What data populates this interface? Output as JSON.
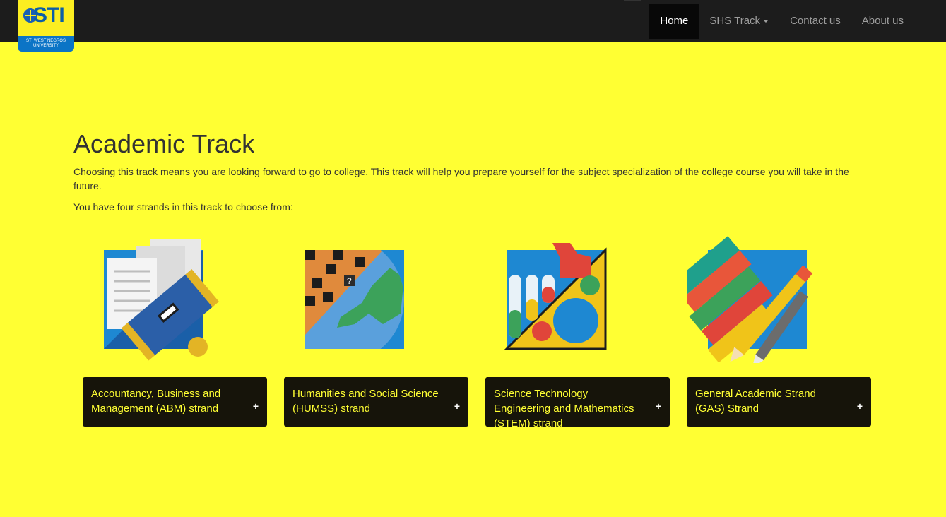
{
  "brand": {
    "logo_text": "STI",
    "logo_subtitle": [
      "STI West Negros",
      "University"
    ]
  },
  "nav": {
    "items": [
      {
        "label": "Home",
        "active": true
      },
      {
        "label": "SHS Track",
        "dropdown": true
      },
      {
        "label": "Contact us"
      },
      {
        "label": "About us"
      }
    ]
  },
  "page": {
    "title": "Academic Track",
    "intro": "Choosing this track means you are looking forward to go to college. This track will help you prepare yourself for the subject specialization of the college course you will take in the future.",
    "choose": "You have four strands in this track to choose from:"
  },
  "strands": [
    {
      "title": "Accountancy, Business and Management (ABM) strand",
      "icon": "briefcase-icon",
      "expand": "+"
    },
    {
      "title": "Humanities and Social Science (HUMSS) strand",
      "icon": "globe-puzzle-icon",
      "expand": "+"
    },
    {
      "title": "Science Technology Engineering and Mathematics (STEM) strand",
      "icon": "lab-tools-icon",
      "expand": "+"
    },
    {
      "title": "General Academic Strand (GAS) Strand",
      "icon": "books-pencil-icon",
      "expand": "+"
    }
  ],
  "colors": {
    "background": "#ffff33",
    "navbar": "#1c1c1c",
    "panel": "#16140a",
    "panel_text": "#ffff33"
  }
}
